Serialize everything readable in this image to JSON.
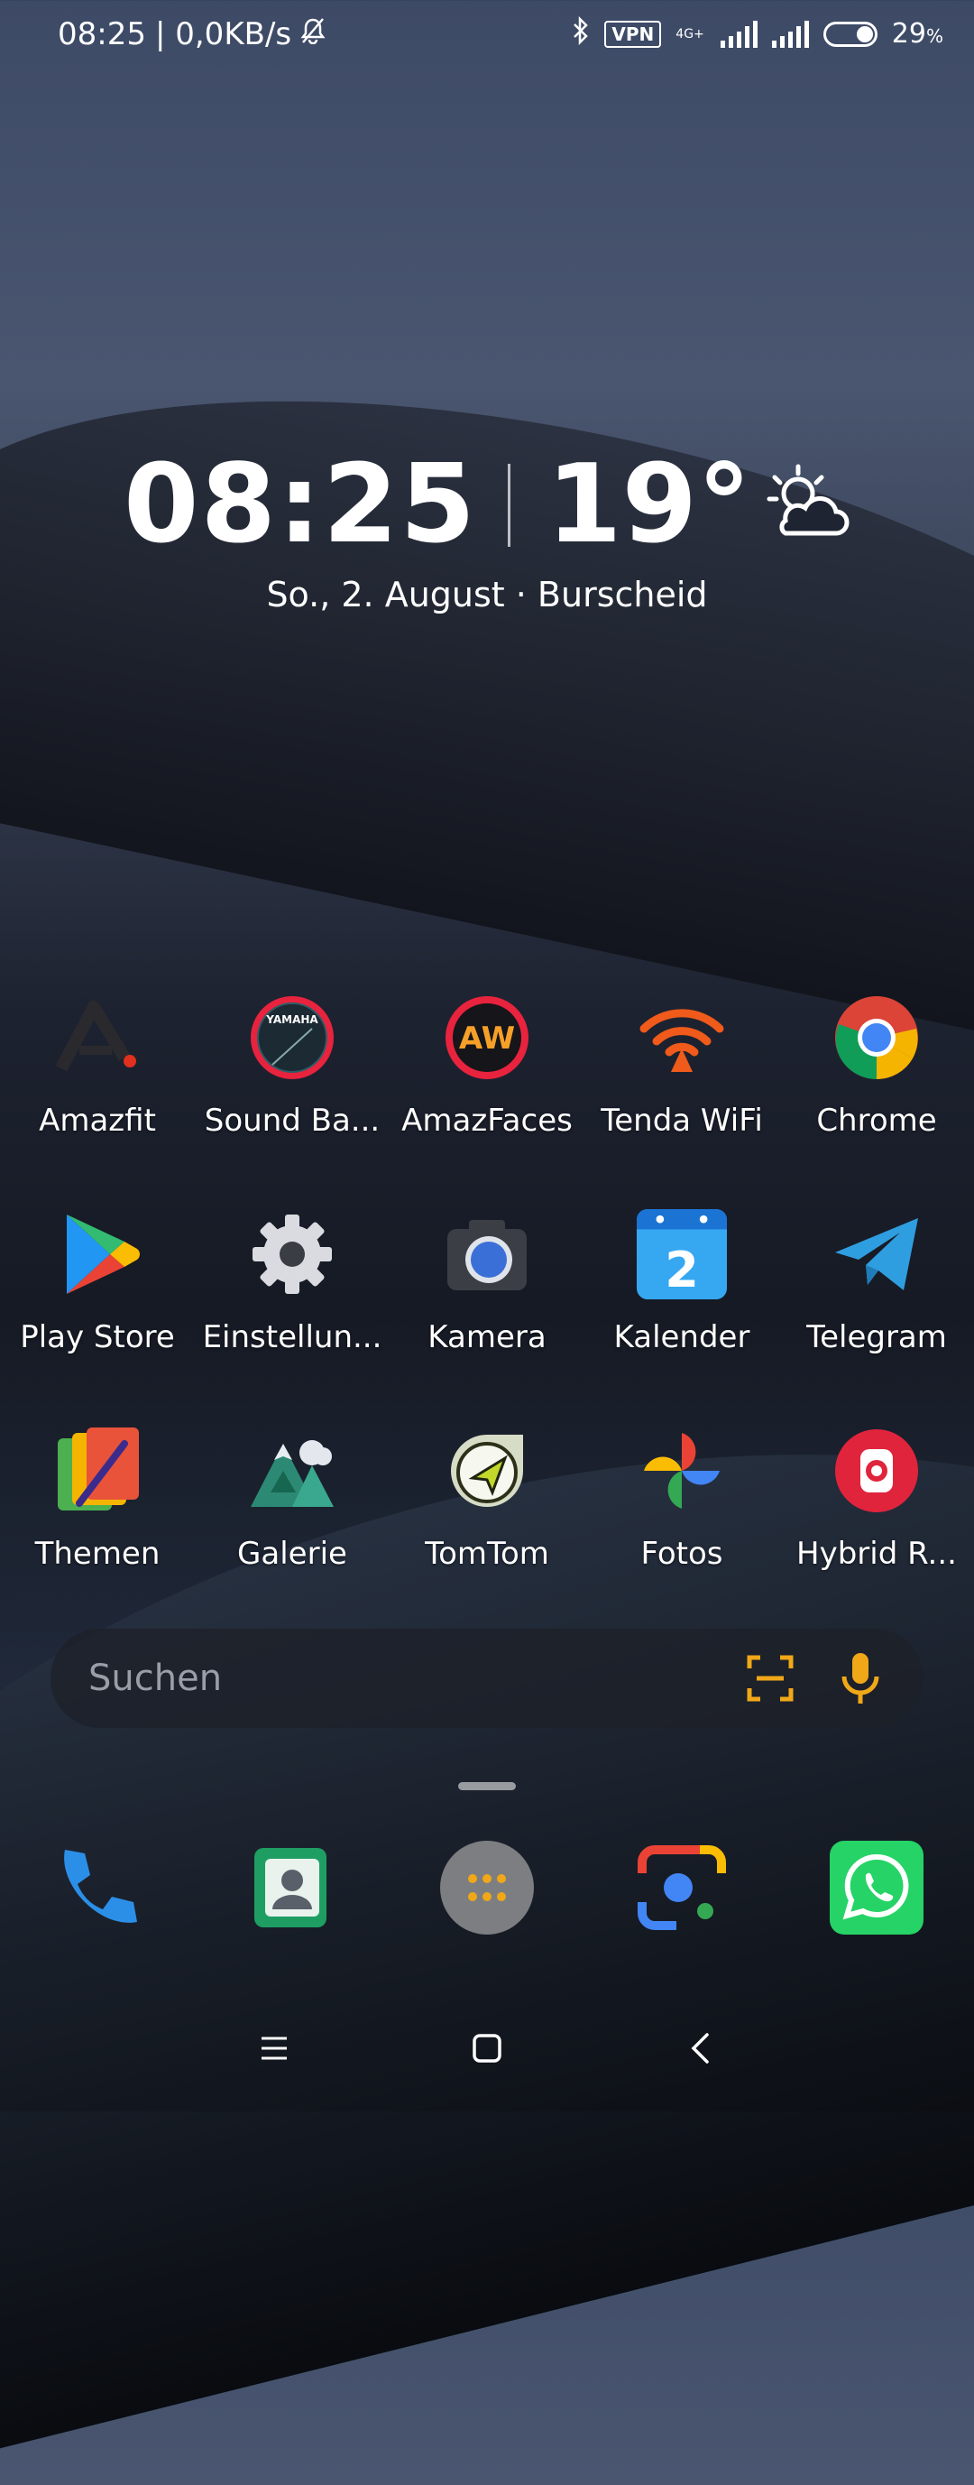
{
  "status_bar": {
    "time": "08:25",
    "speed": "| 0,0KB/s",
    "vpn": "VPN",
    "network_type": "4G+",
    "battery": "29",
    "battery_unit": "%",
    "icons": [
      "mute-bell-icon",
      "bluetooth-icon",
      "vpn-icon",
      "signal-icon",
      "signal-icon",
      "battery-icon"
    ]
  },
  "widget": {
    "clock": "08:25",
    "temperature": "19°",
    "weather_icon": "partly-cloudy-icon",
    "date_location": "So., 2. August · Burscheid"
  },
  "apps": [
    {
      "label": "Amazfit",
      "icon": "amazfit-icon"
    },
    {
      "label": "Sound Ba...",
      "icon": "yamaha-sound-bar-icon"
    },
    {
      "label": "AmazFaces",
      "icon": "amazfaces-icon"
    },
    {
      "label": "Tenda WiFi",
      "icon": "tenda-wifi-icon"
    },
    {
      "label": "Chrome",
      "icon": "chrome-icon"
    },
    {
      "label": "Play Store",
      "icon": "play-store-icon"
    },
    {
      "label": "Einstellun...",
      "icon": "settings-gear-icon"
    },
    {
      "label": "Kamera",
      "icon": "camera-icon"
    },
    {
      "label": "Kalender",
      "icon": "calendar-icon",
      "badge": "2"
    },
    {
      "label": "Telegram",
      "icon": "telegram-icon"
    },
    {
      "label": "Themen",
      "icon": "themes-icon"
    },
    {
      "label": "Galerie",
      "icon": "gallery-icon"
    },
    {
      "label": "TomTom",
      "icon": "tomtom-icon"
    },
    {
      "label": "Fotos",
      "icon": "google-photos-icon"
    },
    {
      "label": "Hybrid R...",
      "icon": "hybrid-r-icon"
    }
  ],
  "search": {
    "placeholder": "Suchen",
    "icons": [
      "scan-icon",
      "microphone-icon"
    ],
    "accent": "#f0a818"
  },
  "dock": [
    {
      "icon": "phone-icon"
    },
    {
      "icon": "contacts-icon"
    },
    {
      "icon": "app-drawer-icon"
    },
    {
      "icon": "google-lens-icon"
    },
    {
      "icon": "whatsapp-icon"
    }
  ],
  "nav": [
    "menu-icon",
    "home-icon",
    "back-icon"
  ]
}
